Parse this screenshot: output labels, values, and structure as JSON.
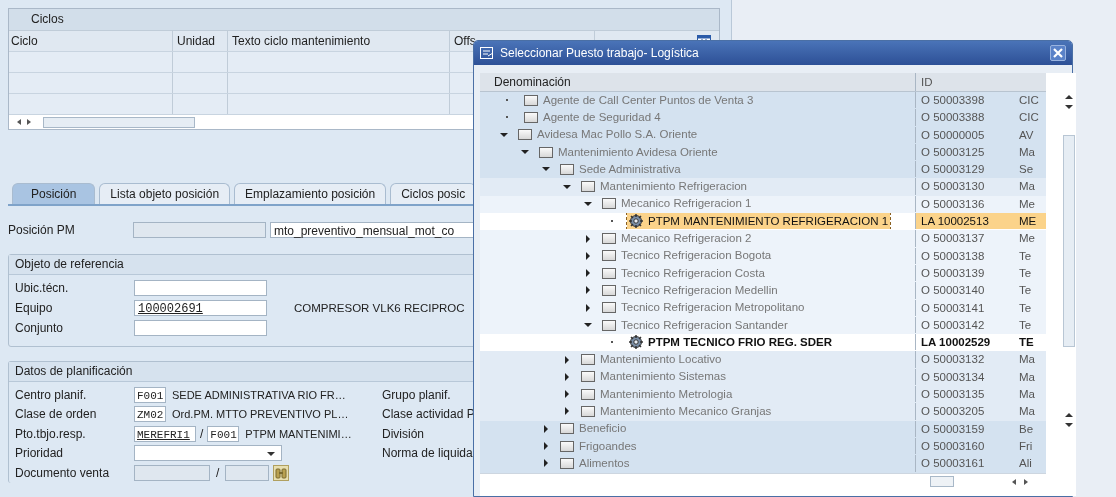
{
  "cycles_table": {
    "title": "Ciclos",
    "columns": [
      "Ciclo",
      "Unidad",
      "Texto ciclo mantenimiento",
      "Offs"
    ]
  },
  "tabs": [
    {
      "label": "Posición",
      "selected": true
    },
    {
      "label": "Lista objeto posición",
      "selected": false
    },
    {
      "label": "Emplazamiento posición",
      "selected": false
    },
    {
      "label": "Ciclos posic",
      "selected": false
    }
  ],
  "position_pm": {
    "label": "Posición PM",
    "value": "mto_preventivo_mensual_mot_co"
  },
  "reference_object": {
    "title": "Objeto de referencia",
    "fields": [
      {
        "label": "Ubic.técn."
      },
      {
        "label": "Equipo",
        "value": "100002691",
        "description": "COMPRESOR VLK6  RECIPROC"
      },
      {
        "label": "Conjunto"
      }
    ]
  },
  "planning": {
    "title": "Datos de planificación",
    "rows": [
      {
        "kind": "code",
        "label": "Centro planif.",
        "value": "F001",
        "description": "SEDE ADMINISTRATIVA RIO FR…",
        "right_label": "Grupo planif."
      },
      {
        "kind": "code",
        "label": "Clase de orden",
        "value": "ZM02",
        "description": "Ord.PM. MTTO PREVENTIVO PL…",
        "right_label": "Clase actividad P"
      },
      {
        "kind": "pair",
        "label": "Pto.tbjo.resp.",
        "value": "MEREFRI1",
        "separator": "/",
        "value_2": "F001",
        "description": "PTPM MANTENIMI…",
        "right_label": "División"
      },
      {
        "kind": "dropdown",
        "label": "Prioridad",
        "right_label": "Norma de liquida"
      },
      {
        "kind": "search",
        "label": "Documento venta",
        "separator": "/"
      }
    ]
  },
  "dialog": {
    "title": "Seleccionar Puesto trabajo- Logística",
    "columns": [
      "Denominación",
      "ID"
    ],
    "tree": [
      {
        "kind": "folder",
        "label": "Agente de Call Center Puntos de Venta 3",
        "id": "O  50003398",
        "column_3": "CIC",
        "expandable": false,
        "selected": false,
        "bold": false
      },
      {
        "kind": "folder",
        "label": "Agente de Seguridad 4",
        "id": "O  50003388",
        "column_3": "CIC",
        "expandable": false,
        "selected": false,
        "bold": false
      },
      {
        "kind": "folder",
        "label": "Avidesa Mac Pollo S.A. Oriente",
        "id": "O  50000005",
        "column_3": "AV",
        "expandable": true,
        "expanded": true,
        "selected": false,
        "bold": false,
        "children": [
          {
            "kind": "folder",
            "label": "Mantenimiento Avidesa Oriente",
            "id": "O  50003125",
            "column_3": "Ma",
            "expandable": true,
            "expanded": true,
            "selected": false,
            "bold": false,
            "children": [
              {
                "kind": "folder",
                "label": "Sede Administrativa",
                "id": "O  50003129",
                "column_3": "Se",
                "expandable": true,
                "expanded": true,
                "selected": false,
                "bold": false,
                "children": [
                  {
                    "kind": "folder",
                    "label": "Mantenimiento Refrigeracion",
                    "id": "O  50003130",
                    "column_3": "Ma",
                    "expandable": true,
                    "expanded": true,
                    "selected": false,
                    "bold": false,
                    "children": [
                      {
                        "kind": "folder",
                        "label": "Mecanico Refrigeracion 1",
                        "id": "O  50003136",
                        "column_3": "Me",
                        "expandable": true,
                        "expanded": true,
                        "selected": false,
                        "bold": false,
                        "children": [
                          {
                            "kind": "workplace",
                            "label": "PTPM MANTENIMIENTO REFRIGERACION 1",
                            "id": "LA 10002513",
                            "column_3": "ME",
                            "expandable": false,
                            "selected": true,
                            "bold": false
                          }
                        ]
                      },
                      {
                        "kind": "folder",
                        "label": "Mecanico Refrigeracion 2",
                        "id": "O  50003137",
                        "column_3": "Me",
                        "expandable": true,
                        "expanded": false,
                        "selected": false,
                        "bold": false
                      },
                      {
                        "kind": "folder",
                        "label": "Tecnico Refrigeracion Bogota",
                        "id": "O  50003138",
                        "column_3": "Te",
                        "expandable": true,
                        "expanded": false,
                        "selected": false,
                        "bold": false
                      },
                      {
                        "kind": "folder",
                        "label": "Tecnico Refrigeracion Costa",
                        "id": "O  50003139",
                        "column_3": "Te",
                        "expandable": true,
                        "expanded": false,
                        "selected": false,
                        "bold": false
                      },
                      {
                        "kind": "folder",
                        "label": "Tecnico Refrigeracion Medellin",
                        "id": "O  50003140",
                        "column_3": "Te",
                        "expandable": true,
                        "expanded": false,
                        "selected": false,
                        "bold": false
                      },
                      {
                        "kind": "folder",
                        "label": "Tecnico Refrigeracion Metropolitano",
                        "id": "O  50003141",
                        "column_3": "Te",
                        "expandable": true,
                        "expanded": false,
                        "selected": false,
                        "bold": false
                      },
                      {
                        "kind": "folder",
                        "label": "Tecnico Refrigeracion Santander",
                        "id": "O  50003142",
                        "column_3": "Te",
                        "expandable": true,
                        "expanded": true,
                        "selected": false,
                        "bold": false,
                        "children": [
                          {
                            "kind": "workplace",
                            "label": "PTPM TECNICO FRIO REG. SDER",
                            "id": "LA 10002529",
                            "column_3": "TE",
                            "expandable": false,
                            "selected": false,
                            "bold": true
                          }
                        ]
                      }
                    ]
                  },
                  {
                    "kind": "folder",
                    "label": "Mantenimiento Locativo",
                    "id": "O  50003132",
                    "column_3": "Ma",
                    "expandable": true,
                    "expanded": false,
                    "selected": false,
                    "bold": false
                  },
                  {
                    "kind": "folder",
                    "label": "Mantenimiento Sistemas",
                    "id": "O  50003134",
                    "column_3": "Ma",
                    "expandable": true,
                    "expanded": false,
                    "selected": false,
                    "bold": false
                  },
                  {
                    "kind": "folder",
                    "label": "Mantenimiento Metrologia",
                    "id": "O  50003135",
                    "column_3": "Ma",
                    "expandable": true,
                    "expanded": false,
                    "selected": false,
                    "bold": false
                  },
                  {
                    "kind": "folder",
                    "label": "Mantenimiento Mecanico Granjas",
                    "id": "O  50003205",
                    "column_3": "Ma",
                    "expandable": true,
                    "expanded": false,
                    "selected": false,
                    "bold": false
                  }
                ]
              },
              {
                "kind": "folder",
                "label": "Beneficio",
                "id": "O  50003159",
                "column_3": "Be",
                "expandable": true,
                "expanded": false,
                "selected": false,
                "bold": false
              },
              {
                "kind": "folder",
                "label": "Frigoandes",
                "id": "O  50003160",
                "column_3": "Fri",
                "expandable": true,
                "expanded": false,
                "selected": false,
                "bold": false
              },
              {
                "kind": "folder",
                "label": "Alimentos",
                "id": "O  50003161",
                "column_3": "Ali",
                "expandable": true,
                "expanded": false,
                "selected": false,
                "bold": false
              }
            ]
          }
        ]
      }
    ]
  }
}
